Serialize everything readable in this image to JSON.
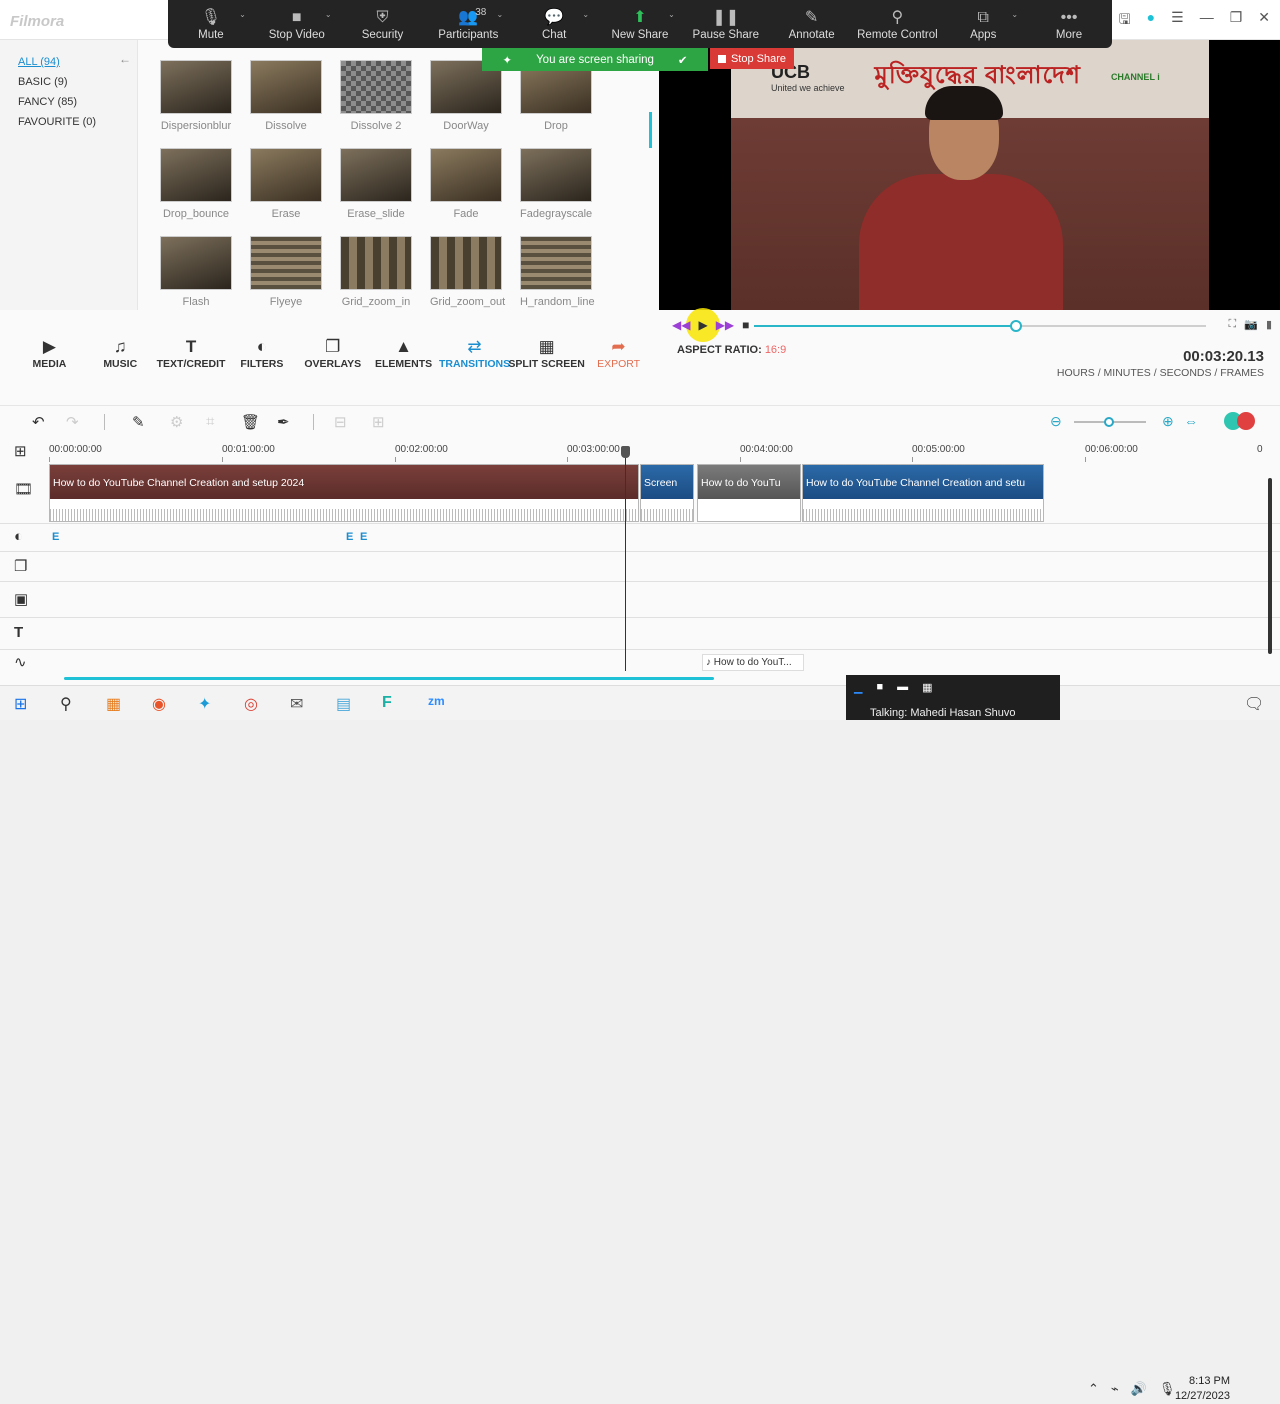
{
  "app": {
    "logo": "Filmora"
  },
  "zoom_toolbar": {
    "items": [
      {
        "label": "Mute",
        "icon": "🎙",
        "caret": true
      },
      {
        "label": "Stop Video",
        "icon": "■",
        "caret": true
      },
      {
        "label": "Security",
        "icon": "⛨",
        "caret": false
      },
      {
        "label": "Participants",
        "icon": "👥",
        "caret": true,
        "count": "38"
      },
      {
        "label": "Chat",
        "icon": "💬",
        "caret": true
      },
      {
        "label": "New Share",
        "icon": "⬆",
        "caret": true
      },
      {
        "label": "Pause Share",
        "icon": "❚❚",
        "caret": false
      },
      {
        "label": "Annotate",
        "icon": "✎",
        "caret": false
      },
      {
        "label": "Remote Control",
        "icon": "⚲",
        "caret": false
      },
      {
        "label": "Apps",
        "icon": "⧉",
        "caret": true
      },
      {
        "label": "More",
        "icon": "•••",
        "caret": false
      }
    ],
    "sharing_text": "You are screen sharing",
    "stop_share": "Stop Share",
    "accent_green": "#2ea544",
    "stop_red": "#d93a36"
  },
  "categories": [
    "ALL (94)",
    "BASIC (9)",
    "FANCY (85)",
    "FAVOURITE (0)"
  ],
  "transitions": [
    "Dispersionblur",
    "Dissolve",
    "Dissolve 2",
    "DoorWay",
    "Drop",
    "Drop_bounce",
    "Erase",
    "Erase_slide",
    "Fade",
    "Fadegrayscale",
    "Flash",
    "Flyeye",
    "Grid_zoom_in",
    "Grid_zoom_out",
    "H_random_line"
  ],
  "preview": {
    "banner_left": "UCB",
    "banner_tagline": "United we achieve",
    "banner_text": "মুক্তিযুদ্ধের বাংলাদেশ",
    "channel": "CHANNEL i",
    "aspect_label": "ASPECT RATIO:",
    "aspect_value": "16:9",
    "timecode": "00:03:20.13",
    "timecode_units": "HOURS / MINUTES / SECONDS / FRAMES",
    "progress": 0.58
  },
  "tools": [
    {
      "label": "MEDIA",
      "icon": "▶"
    },
    {
      "label": "MUSIC",
      "icon": "♫"
    },
    {
      "label": "TEXT/CREDIT",
      "icon": "T"
    },
    {
      "label": "FILTERS",
      "icon": "◐"
    },
    {
      "label": "OVERLAYS",
      "icon": "❐"
    },
    {
      "label": "ELEMENTS",
      "icon": "▲"
    },
    {
      "label": "TRANSITIONS",
      "icon": "⇄"
    },
    {
      "label": "SPLIT SCREEN",
      "icon": "▦"
    },
    {
      "label": "EXPORT",
      "icon": "➦"
    }
  ],
  "ruler": [
    "00:00:00:00",
    "00:01:00:00",
    "00:02:00:00",
    "00:03:00:00",
    "00:04:00:00",
    "00:05:00:00",
    "00:06:00:00",
    "0"
  ],
  "clips": [
    "How to do YouTube Channel Creation and setup 2024",
    "Screen",
    "How to do YouTu",
    "How to do YouTube Channel Creation and setu"
  ],
  "audio_clip": "How to do YouT...",
  "effects_marks": [
    "E",
    "E",
    "E"
  ],
  "taskbar": {
    "zoom_talking": "Talking: Mahedi Hasan Shuvo",
    "time": "8:13 PM",
    "date": "12/27/2023"
  }
}
